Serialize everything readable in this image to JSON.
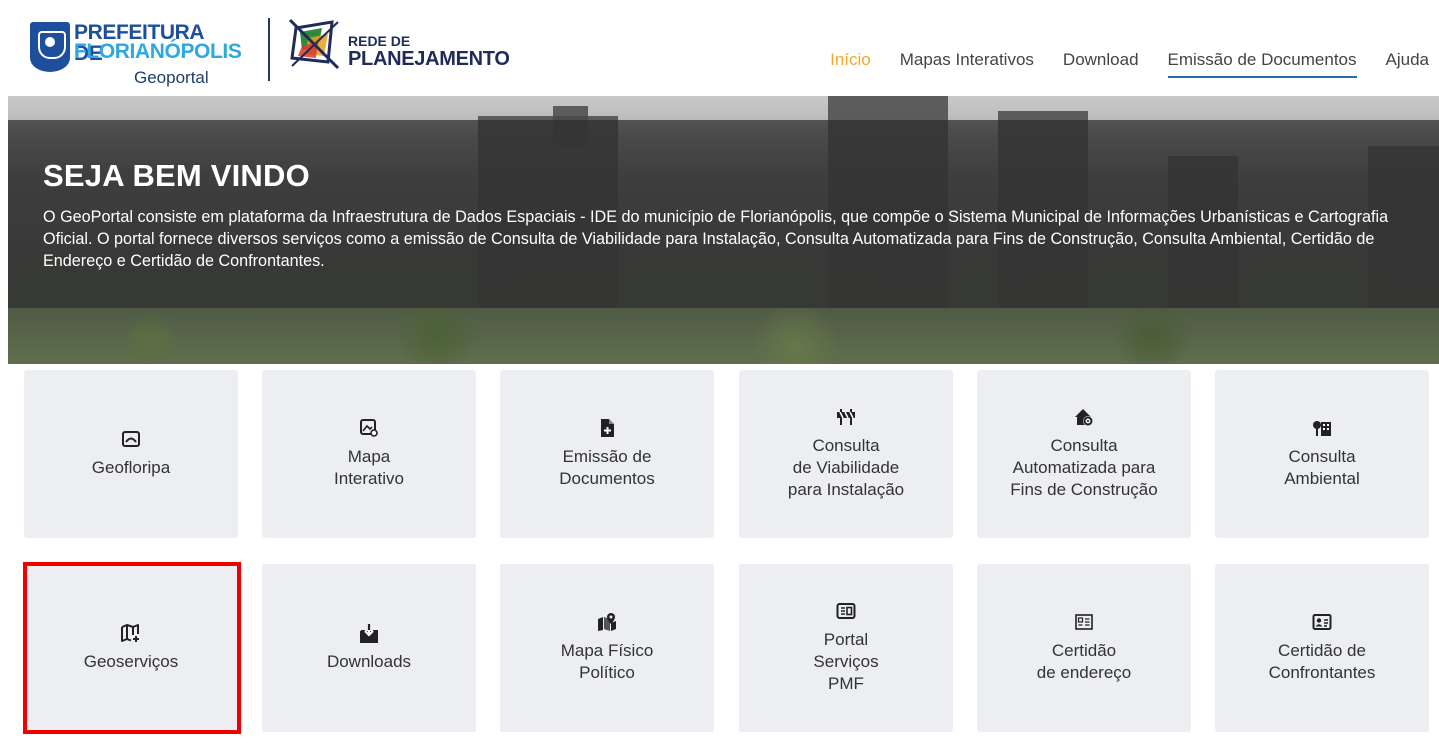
{
  "header": {
    "logo_pmf": {
      "line1": "PREFEITURA DE",
      "line2": "FLORIANÓPOLIS",
      "line3": "Geoportal"
    },
    "logo_rede": {
      "line1": "REDE DE",
      "line2": "PLANEJAMENTO"
    },
    "nav": [
      {
        "label": "Início",
        "state": "active"
      },
      {
        "label": "Mapas Interativos"
      },
      {
        "label": "Download"
      },
      {
        "label": "Emissão de Documentos",
        "state": "underlined"
      },
      {
        "label": "Ajuda"
      }
    ]
  },
  "hero": {
    "title": "SEJA BEM VINDO",
    "text": "O GeoPortal consiste em plataforma da Infraestrutura de Dados Espaciais - IDE do município de Florianópolis, que compõe o Sistema Municipal de Informações Urbanísticas e Cartografia Oficial. O portal fornece diversos serviços como a emissão de Consulta de Viabilidade para Instalação, Consulta Automatizada para Fins de Construção, Consulta Ambiental, Certidão de Endereço e Certidão de Confrontantes."
  },
  "tiles": [
    {
      "label": "Geofloripa",
      "icon": "globe-frame-icon"
    },
    {
      "label": "Mapa\nInterativo",
      "icon": "map-image-icon"
    },
    {
      "label": "Emissão de\nDocumentos",
      "icon": "file-plus-icon"
    },
    {
      "label": "Consulta\nde Viabilidade\npara Instalação",
      "icon": "barrier-icon"
    },
    {
      "label": "Consulta\nAutomatizada para\nFins de Construção",
      "icon": "house-gear-icon"
    },
    {
      "label": "Consulta\nAmbiental",
      "icon": "tree-building-icon"
    },
    {
      "label": "Geoserviços",
      "icon": "map-plus-icon"
    },
    {
      "label": "Downloads",
      "icon": "download-box-icon"
    },
    {
      "label": "Mapa Físico\nPolítico",
      "icon": "map-pin-icon"
    },
    {
      "label": "Portal\nServiços\nPMF",
      "icon": "id-screen-icon"
    },
    {
      "label": "Certidão\nde endereço",
      "icon": "address-card-icon"
    },
    {
      "label": "Certidão de\nConfrontantes",
      "icon": "contact-card-icon"
    }
  ],
  "colors": {
    "nav_active": "#f0a830",
    "nav_underline": "#2a6aa8",
    "tile_bg": "#eceef2",
    "highlight": "#ee0000",
    "brand_blue": "#1d4f9c",
    "brand_light_blue": "#2fa8e1"
  }
}
